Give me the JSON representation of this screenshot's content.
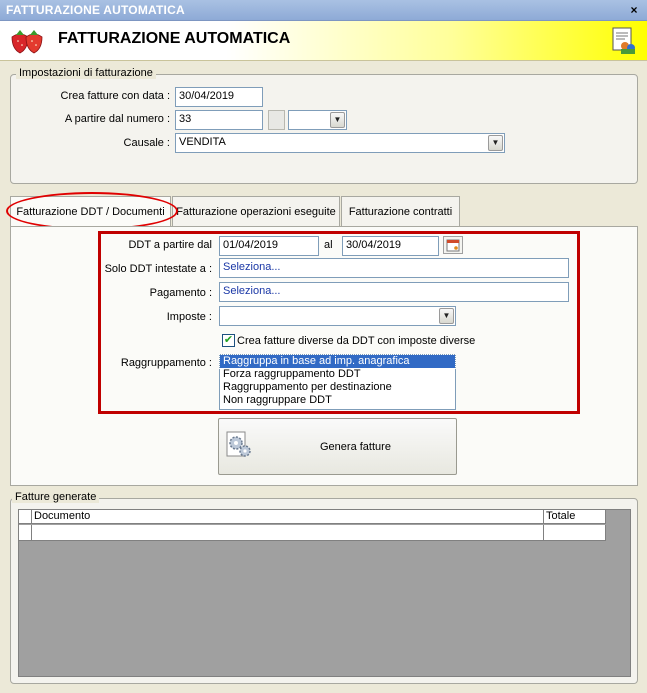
{
  "window": {
    "title": "FATTURAZIONE AUTOMATICA",
    "close_glyph": "×"
  },
  "banner": {
    "heading": "FATTURAZIONE AUTOMATICA",
    "left_icon": "strawberries-icon",
    "right_icon": "document-people-icon"
  },
  "settings": {
    "legend": "Impostazioni di fatturazione",
    "date_label": "Crea fatture con data :",
    "date_value": "30/04/2019",
    "number_label": "A partire dal numero :",
    "number_value": "33",
    "causale_label": "Causale :",
    "causale_value": "VENDITA"
  },
  "tabs": [
    {
      "label": "Fatturazione DDT / Documenti",
      "active": true
    },
    {
      "label": "Fatturazione operazioni eseguite",
      "active": false
    },
    {
      "label": "Fatturazione contratti",
      "active": false
    }
  ],
  "ddt": {
    "from_label": "DDT a partire dal",
    "from_value": "01/04/2019",
    "al_label": "al",
    "to_value": "30/04/2019",
    "intestate_label": "Solo DDT intestate a :",
    "intestate_value": "Seleziona...",
    "pagamento_label": "Pagamento :",
    "pagamento_value": "Seleziona...",
    "imposte_label": "Imposte :",
    "imposte_value": "",
    "checkbox_label": "Crea fatture diverse da DDT con imposte diverse",
    "checkbox_checked": true,
    "raggruppamento_label": "Raggruppamento :",
    "raggruppamento_options": [
      "Raggruppa in base ad imp. anagrafica",
      "Forza raggruppamento DDT",
      "Raggruppamento per destinazione",
      "Non raggruppare DDT"
    ],
    "raggruppamento_selected": 0
  },
  "generate": {
    "label": "Genera fatture",
    "icon": "gears-document-icon"
  },
  "results": {
    "legend": "Fatture generate",
    "columns": [
      "Documento",
      "Totale"
    ]
  },
  "colors": {
    "highlight_red": "#c00000",
    "selection_blue": "#316ac5",
    "link_blue": "#1a37a6"
  }
}
